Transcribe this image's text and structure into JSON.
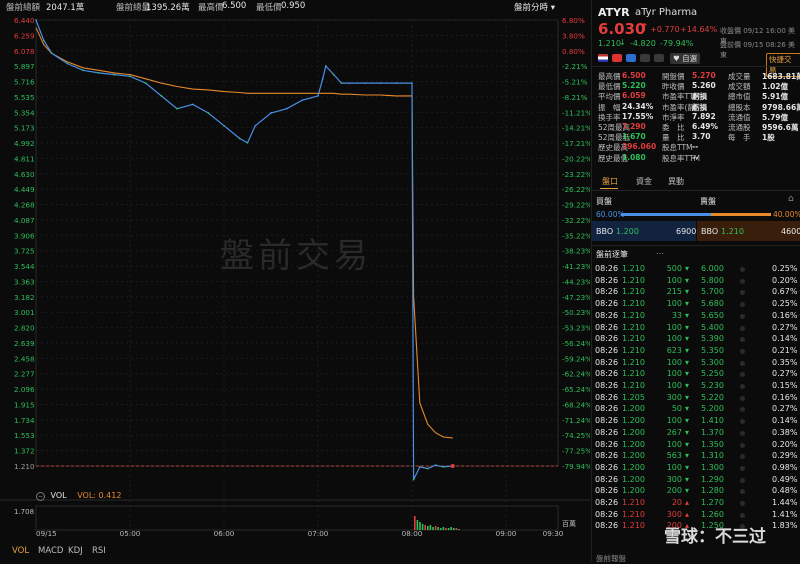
{
  "topbar": {
    "vol_label": "盤前總額",
    "vol_value": "2047.1萬",
    "amt_label": "盤前總量",
    "amt_value": "1395.26萬",
    "high_label": "最高價",
    "high_value": "6.500",
    "low_label": "最低價",
    "low_value": "0.950",
    "mode_label": "盤前分時"
  },
  "watermark": "盤前交易",
  "left_axis": [
    "6.440",
    "6.259",
    "6.078",
    "5.897",
    "5.716",
    "5.535",
    "5.354",
    "5.173",
    "4.992",
    "4.811",
    "4.630",
    "4.449",
    "4.268",
    "4.087",
    "3.906",
    "3.725",
    "3.544",
    "3.363",
    "3.182",
    "3.001",
    "2.820",
    "2.639",
    "2.458",
    "2.277",
    "2.096",
    "1.915",
    "1.734",
    "1.553",
    "1.372",
    "1.210"
  ],
  "right_axis": [
    "6.80%",
    "3.80%",
    "0.80%",
    "-2.21%",
    "-5.21%",
    "-8.21%",
    "-11.21%",
    "-14.21%",
    "-17.21%",
    "-20.22%",
    "-23.22%",
    "-26.22%",
    "-29.22%",
    "-32.22%",
    "-35.22%",
    "-38.23%",
    "-41.23%",
    "-44.23%",
    "-47.23%",
    "-50.23%",
    "-53.23%",
    "-56.24%",
    "-59.24%",
    "-62.24%",
    "-65.24%",
    "-68.24%",
    "-71.24%",
    "-74.25%",
    "-77.25%",
    "-79.94%"
  ],
  "time_axis": [
    "09/15",
    "05:00",
    "06:00",
    "07:00",
    "08:00",
    "09:00",
    "09:30"
  ],
  "vol_legend": {
    "label": "VOL",
    "value_label": "VOL: 0.412"
  },
  "vol_axis": {
    "max": "1.708",
    "unit": "百萬"
  },
  "bottom_tabs": [
    "VOL",
    "MACD",
    "KDJ",
    "RSI"
  ],
  "quote": {
    "symbol": "ATYR",
    "name": "aTyr Pharma",
    "price": "6.030",
    "change": "+0.770",
    "change_pct": "+14.64%",
    "close_note": "收盤價 09/12 16:00 美東",
    "pre_price": "1.210",
    "pre_change": "-4.820",
    "pre_change_pct": "-79.94%",
    "pre_note": "盤前價 09/15 08:26 美東",
    "watchlist_label": "自選",
    "quick_trade_label": "快捷交易"
  },
  "stats": [
    [
      {
        "k": "最高價",
        "v": "6.500",
        "c": "up"
      },
      {
        "k": "開盤價",
        "v": "5.270",
        "c": "up"
      },
      {
        "k": "成交量",
        "v": "1683.81萬",
        "c": "white"
      }
    ],
    [
      {
        "k": "最低價",
        "v": "5.220",
        "c": "dn"
      },
      {
        "k": "昨收價",
        "v": "5.260",
        "c": "white"
      },
      {
        "k": "成交額",
        "v": "1.02億",
        "c": "white"
      }
    ],
    [
      {
        "k": "平均價",
        "v": "6.059",
        "c": "up"
      },
      {
        "k": "市盈率TTM",
        "v": "虧損",
        "c": "white"
      },
      {
        "k": "總市值",
        "v": "5.91億",
        "c": "white"
      }
    ],
    [
      {
        "k": "振　幅",
        "v": "24.34%",
        "c": "white"
      },
      {
        "k": "市盈率(靜)",
        "v": "虧損",
        "c": "white"
      },
      {
        "k": "總股本",
        "v": "9798.66萬",
        "c": "white"
      }
    ],
    [
      {
        "k": "換手率",
        "v": "17.55%",
        "c": "white"
      },
      {
        "k": "市淨率",
        "v": "7.892",
        "c": "white"
      },
      {
        "k": "流通值",
        "v": "5.79億",
        "c": "white"
      }
    ],
    [
      {
        "k": "52周最高",
        "v": "7.290",
        "c": "up"
      },
      {
        "k": "委　比",
        "v": "6.49%",
        "c": "white"
      },
      {
        "k": "流通股",
        "v": "9596.6萬",
        "c": "white"
      }
    ],
    [
      {
        "k": "52周最低",
        "v": "1.670",
        "c": "dn"
      },
      {
        "k": "量　比",
        "v": "3.70",
        "c": "white"
      },
      {
        "k": "每　手",
        "v": "1股",
        "c": "white"
      }
    ],
    [
      {
        "k": "歷史最高",
        "v": "396.060",
        "c": "up"
      },
      {
        "k": "股息TTM",
        "v": "--",
        "c": "white"
      }
    ],
    [
      {
        "k": "歷史最低",
        "v": "1.080",
        "c": "dn"
      },
      {
        "k": "股息率TTM",
        "v": "--",
        "c": "white"
      }
    ]
  ],
  "tabs": [
    "盤口",
    "資金",
    "異動"
  ],
  "book": {
    "bid_label": "買盤",
    "ask_label": "賣盤",
    "bid_pct": "60.00%",
    "ask_pct": "40.00%",
    "bid_fraction": 0.6,
    "bbo_bid_label": "BBO",
    "bbo_bid_price": "1.200",
    "bbo_bid_size": "6900",
    "bbo_ask_label": "BBO",
    "bbo_ask_price": "1.210",
    "bbo_ask_size": "4600"
  },
  "trades_title": "盤前逐筆",
  "trades": [
    {
      "t": "08:26",
      "p": "1.210",
      "v": "500",
      "d": "dn"
    },
    {
      "t": "08:26",
      "p": "1.210",
      "v": "100",
      "d": "dn"
    },
    {
      "t": "08:26",
      "p": "1.210",
      "v": "215",
      "d": "dn"
    },
    {
      "t": "08:26",
      "p": "1.210",
      "v": "100",
      "d": "dn"
    },
    {
      "t": "08:26",
      "p": "1.210",
      "v": "33",
      "d": "dn"
    },
    {
      "t": "08:26",
      "p": "1.210",
      "v": "100",
      "d": "dn"
    },
    {
      "t": "08:26",
      "p": "1.210",
      "v": "100",
      "d": "dn"
    },
    {
      "t": "08:26",
      "p": "1.210",
      "v": "623",
      "d": "dn"
    },
    {
      "t": "08:26",
      "p": "1.210",
      "v": "100",
      "d": "dn"
    },
    {
      "t": "08:26",
      "p": "1.210",
      "v": "100",
      "d": "dn"
    },
    {
      "t": "08:26",
      "p": "1.210",
      "v": "100",
      "d": "dn"
    },
    {
      "t": "08:26",
      "p": "1.205",
      "v": "300",
      "d": "dn"
    },
    {
      "t": "08:26",
      "p": "1.200",
      "v": "50",
      "d": "dn"
    },
    {
      "t": "08:26",
      "p": "1.200",
      "v": "100",
      "d": "dn"
    },
    {
      "t": "08:26",
      "p": "1.200",
      "v": "267",
      "d": "dn"
    },
    {
      "t": "08:26",
      "p": "1.200",
      "v": "100",
      "d": "dn"
    },
    {
      "t": "08:26",
      "p": "1.200",
      "v": "563",
      "d": "dn"
    },
    {
      "t": "08:26",
      "p": "1.200",
      "v": "100",
      "d": "dn"
    },
    {
      "t": "08:26",
      "p": "1.200",
      "v": "300",
      "d": "dn"
    },
    {
      "t": "08:26",
      "p": "1.200",
      "v": "200",
      "d": "dn"
    },
    {
      "t": "08:26",
      "p": "1.210",
      "v": "20",
      "d": "up"
    },
    {
      "t": "08:26",
      "p": "1.210",
      "v": "300",
      "d": "up"
    },
    {
      "t": "08:26",
      "p": "1.210",
      "v": "200",
      "d": "up"
    }
  ],
  "price_dist": [
    {
      "p": "6.000",
      "pct": "0.25%"
    },
    {
      "p": "5.800",
      "pct": "0.20%"
    },
    {
      "p": "5.700",
      "pct": "0.67%"
    },
    {
      "p": "5.680",
      "pct": "0.25%"
    },
    {
      "p": "5.650",
      "pct": "0.16%"
    },
    {
      "p": "5.400",
      "pct": "0.27%"
    },
    {
      "p": "5.390",
      "pct": "0.14%"
    },
    {
      "p": "5.350",
      "pct": "0.21%"
    },
    {
      "p": "5.300",
      "pct": "0.35%"
    },
    {
      "p": "5.250",
      "pct": "0.27%"
    },
    {
      "p": "5.230",
      "pct": "0.15%"
    },
    {
      "p": "5.220",
      "pct": "0.16%"
    },
    {
      "p": "5.200",
      "pct": "0.27%"
    },
    {
      "p": "1.410",
      "pct": "0.14%"
    },
    {
      "p": "1.370",
      "pct": "0.38%"
    },
    {
      "p": "1.350",
      "pct": "0.20%"
    },
    {
      "p": "1.310",
      "pct": "0.29%"
    },
    {
      "p": "1.300",
      "pct": "0.98%"
    },
    {
      "p": "1.290",
      "pct": "0.49%"
    },
    {
      "p": "1.280",
      "pct": "0.48%"
    },
    {
      "p": "1.270",
      "pct": "1.44%"
    },
    {
      "p": "1.260",
      "pct": "1.41%"
    },
    {
      "p": "1.250",
      "pct": "1.83%"
    }
  ],
  "footer_text": "盤前報盤",
  "brand_watermark": "雪球：不三过",
  "colors": {
    "up": "#e23c3c",
    "down": "#2fbf5a",
    "price_line": "#4a8fe8",
    "avg_line": "#e8892c",
    "accent": "#e8a040"
  },
  "chart_data": {
    "type": "line",
    "title": "",
    "x": [
      "04:00",
      "04:05",
      "04:10",
      "04:20",
      "04:30",
      "04:40",
      "04:50",
      "05:00",
      "05:10",
      "05:20",
      "05:30",
      "05:40",
      "05:50",
      "06:00",
      "06:10",
      "06:15",
      "06:20",
      "06:30",
      "06:40",
      "06:50",
      "07:00",
      "07:03",
      "07:05",
      "07:10",
      "07:15",
      "07:20",
      "07:30",
      "07:40",
      "07:50",
      "08:00",
      "08:01",
      "08:05",
      "08:10",
      "08:15",
      "08:20",
      "08:26"
    ],
    "series": [
      {
        "name": "price",
        "values": [
          6.44,
          6.2,
          6.05,
          5.93,
          5.85,
          5.82,
          5.8,
          5.78,
          5.7,
          5.55,
          5.4,
          5.45,
          5.35,
          5.2,
          5.05,
          5.0,
          5.2,
          5.35,
          5.4,
          5.5,
          5.55,
          5.75,
          5.9,
          5.8,
          5.7,
          5.7,
          5.7,
          5.7,
          5.7,
          5.7,
          1.05,
          1.2,
          1.18,
          1.22,
          1.2,
          1.21
        ]
      },
      {
        "name": "avg",
        "values": [
          6.35,
          6.15,
          6.05,
          5.95,
          5.88,
          5.85,
          5.82,
          5.8,
          5.75,
          5.7,
          5.66,
          5.63,
          5.62,
          5.6,
          5.59,
          5.58,
          5.58,
          5.58,
          5.58,
          5.58,
          5.58,
          5.58,
          5.58,
          5.58,
          5.57,
          5.57,
          5.56,
          5.56,
          5.55,
          5.55,
          3.2,
          1.95,
          1.7,
          1.6,
          1.55,
          1.54
        ]
      }
    ],
    "ylim": [
      1.21,
      6.44
    ],
    "pre_close": 1.21,
    "xlabel": "",
    "ylabel": ""
  }
}
